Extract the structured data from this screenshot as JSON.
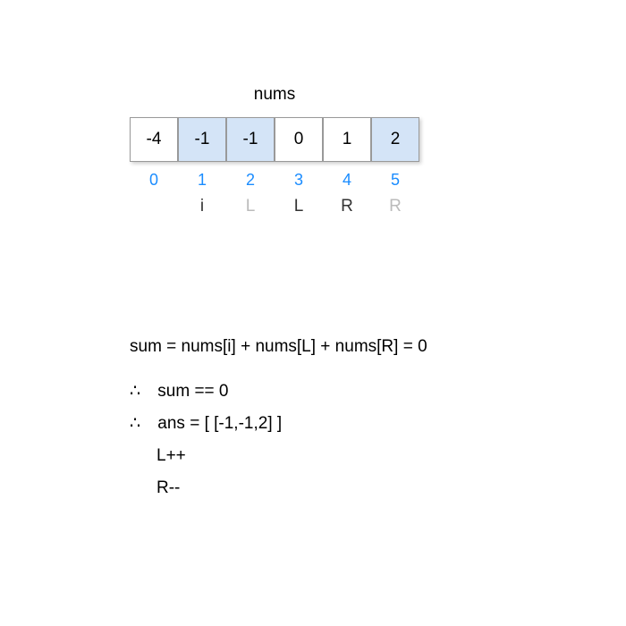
{
  "title": "nums",
  "cells": [
    {
      "value": "-4",
      "highlight": false
    },
    {
      "value": "-1",
      "highlight": true
    },
    {
      "value": "-1",
      "highlight": true
    },
    {
      "value": "0",
      "highlight": false
    },
    {
      "value": "1",
      "highlight": false
    },
    {
      "value": "2",
      "highlight": true
    }
  ],
  "indices": [
    "0",
    "1",
    "2",
    "3",
    "4",
    "5"
  ],
  "pointers": [
    {
      "label": "",
      "faded": false
    },
    {
      "label": "i",
      "faded": false
    },
    {
      "label": "L",
      "faded": true
    },
    {
      "label": "L",
      "faded": false
    },
    {
      "label": "R",
      "faded": false
    },
    {
      "label": "R",
      "faded": true
    }
  ],
  "explanation": {
    "line1": "sum = nums[i] + nums[L] + nums[R] = 0",
    "line2_symbol": "∴",
    "line2": "sum == 0",
    "line3_symbol": "∴",
    "line3": "ans = [ [-1,-1,2] ]",
    "line4": "L++",
    "line5": "R--"
  },
  "chart_data": {
    "type": "table",
    "array_name": "nums",
    "array_values": [
      -4,
      -1,
      -1,
      0,
      1,
      2
    ],
    "indices": [
      0,
      1,
      2,
      3,
      4,
      5
    ],
    "highlighted_indices": [
      1,
      2,
      5
    ],
    "pointers": {
      "i": 1,
      "L_prev": 2,
      "L": 3,
      "R": 4,
      "R_prev": 5
    },
    "sum_expression": "nums[i] + nums[L] + nums[R]",
    "sum_result": 0,
    "condition": "sum == 0",
    "answer": [
      [
        -1,
        -1,
        2
      ]
    ],
    "operations": [
      "L++",
      "R--"
    ]
  }
}
